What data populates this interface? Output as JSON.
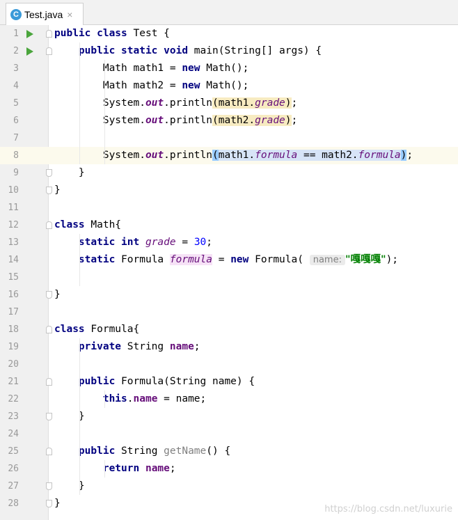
{
  "tab": {
    "icon_letter": "C",
    "file_name": "Test.java",
    "close_glyph": "×"
  },
  "hint": {
    "param_name": "name:"
  },
  "lines": [
    {
      "num": "1"
    },
    {
      "num": "2"
    },
    {
      "num": "3"
    },
    {
      "num": "4"
    },
    {
      "num": "5"
    },
    {
      "num": "6"
    },
    {
      "num": "7"
    },
    {
      "num": "8"
    },
    {
      "num": "9"
    },
    {
      "num": "10"
    },
    {
      "num": "11"
    },
    {
      "num": "12"
    },
    {
      "num": "13"
    },
    {
      "num": "14"
    },
    {
      "num": "15"
    },
    {
      "num": "16"
    },
    {
      "num": "17"
    },
    {
      "num": "18"
    },
    {
      "num": "19"
    },
    {
      "num": "20"
    },
    {
      "num": "21"
    },
    {
      "num": "22"
    },
    {
      "num": "23"
    },
    {
      "num": "24"
    },
    {
      "num": "25"
    },
    {
      "num": "26"
    },
    {
      "num": "27"
    },
    {
      "num": "28"
    }
  ],
  "code": {
    "l1": [
      [
        "kw",
        "public"
      ],
      [
        "",
        ""
      ],
      [
        "kw",
        " class"
      ],
      [
        "",
        " Test {"
      ]
    ],
    "l2": [
      [
        "",
        "    "
      ],
      [
        "kw",
        "public static void"
      ],
      [
        "",
        " main(String[] args) {"
      ]
    ],
    "l3": [
      [
        "",
        "        Math math1 = "
      ],
      [
        "kw",
        "new"
      ],
      [
        "",
        " Math();"
      ]
    ],
    "l4": [
      [
        "",
        "        Math math2 = "
      ],
      [
        "kw",
        "new"
      ],
      [
        "",
        " Math();"
      ]
    ],
    "l5": [
      [
        "",
        "        System."
      ],
      [
        "sfldb",
        "out"
      ],
      [
        "",
        ".println"
      ],
      [
        "hl-tan",
        "("
      ],
      [
        "hl-tan",
        "math1."
      ],
      [
        "sfld hl-tan",
        "grade"
      ],
      [
        "hl-tan",
        ")"
      ],
      [
        "",
        ";"
      ]
    ],
    "l6": [
      [
        "",
        "        System."
      ],
      [
        "sfldb",
        "out"
      ],
      [
        "",
        ".println"
      ],
      [
        "hl-tan",
        "("
      ],
      [
        "hl-tan",
        "math2."
      ],
      [
        "sfld hl-tan",
        "grade"
      ],
      [
        "hl-tan",
        ")"
      ],
      [
        "",
        ";"
      ]
    ],
    "l8": [
      [
        "",
        "        System."
      ],
      [
        "sfldb",
        "out"
      ],
      [
        "",
        ".println"
      ],
      [
        "hl-brace",
        "("
      ],
      [
        "hl-blue",
        "math1."
      ],
      [
        "sfld hl-blue",
        "formula"
      ],
      [
        "hl-blue",
        " == math2."
      ],
      [
        "sfld hl-blue",
        "formula"
      ],
      [
        "hl-brace",
        ")"
      ],
      [
        "",
        ";"
      ]
    ],
    "l9": [
      [
        "",
        "    }"
      ]
    ],
    "l10": [
      [
        "",
        "}"
      ]
    ],
    "l12": [
      [
        "kw",
        "class"
      ],
      [
        "",
        " Math{"
      ]
    ],
    "l13": [
      [
        "",
        "    "
      ],
      [
        "kw",
        "static int"
      ],
      [
        "",
        " "
      ],
      [
        "sfld",
        "grade"
      ],
      [
        "",
        " = "
      ],
      [
        "num",
        "30"
      ],
      [
        "",
        ";"
      ]
    ],
    "l14a": [
      [
        "",
        "    "
      ],
      [
        "kw",
        "static"
      ],
      [
        "",
        " Formula "
      ],
      [
        "sfld hl-pink",
        "formula"
      ],
      [
        "",
        " = "
      ],
      [
        "kw",
        "new"
      ],
      [
        "",
        " Formula( "
      ]
    ],
    "l14b": [
      [
        "",
        ""
      ],
      [
        "str",
        "\"嘎嘎嘎\""
      ],
      [
        "",
        ");"
      ]
    ],
    "l16": [
      [
        "",
        "}"
      ]
    ],
    "l18": [
      [
        "kw",
        "class"
      ],
      [
        "",
        " Formula{"
      ]
    ],
    "l19": [
      [
        "",
        "    "
      ],
      [
        "kw",
        "private"
      ],
      [
        "",
        " String "
      ],
      [
        "fld",
        "name"
      ],
      [
        "",
        ";"
      ]
    ],
    "l21": [
      [
        "",
        "    "
      ],
      [
        "kw",
        "public"
      ],
      [
        "",
        " Formula(String name) {"
      ]
    ],
    "l22": [
      [
        "",
        "        "
      ],
      [
        "kw",
        "this"
      ],
      [
        "",
        "."
      ],
      [
        "fld",
        "name"
      ],
      [
        "",
        " = name;"
      ]
    ],
    "l23": [
      [
        "",
        "    }"
      ]
    ],
    "l25": [
      [
        "",
        "    "
      ],
      [
        "kw",
        "public"
      ],
      [
        "",
        " String "
      ],
      [
        "gray",
        "getName"
      ],
      [
        "",
        "() {"
      ]
    ],
    "l26": [
      [
        "",
        "        "
      ],
      [
        "kw",
        "return"
      ],
      [
        "",
        " "
      ],
      [
        "fld",
        "name"
      ],
      [
        "",
        ";"
      ]
    ],
    "l27": [
      [
        "",
        "    }"
      ]
    ],
    "l28": [
      [
        "",
        "}"
      ]
    ]
  },
  "watermark": "https://blog.csdn.net/luxurie",
  "colors": {
    "keyword": "#000080",
    "field": "#660e7a",
    "number": "#0000ff",
    "string": "#008000",
    "current_line": "#fcfaed"
  }
}
